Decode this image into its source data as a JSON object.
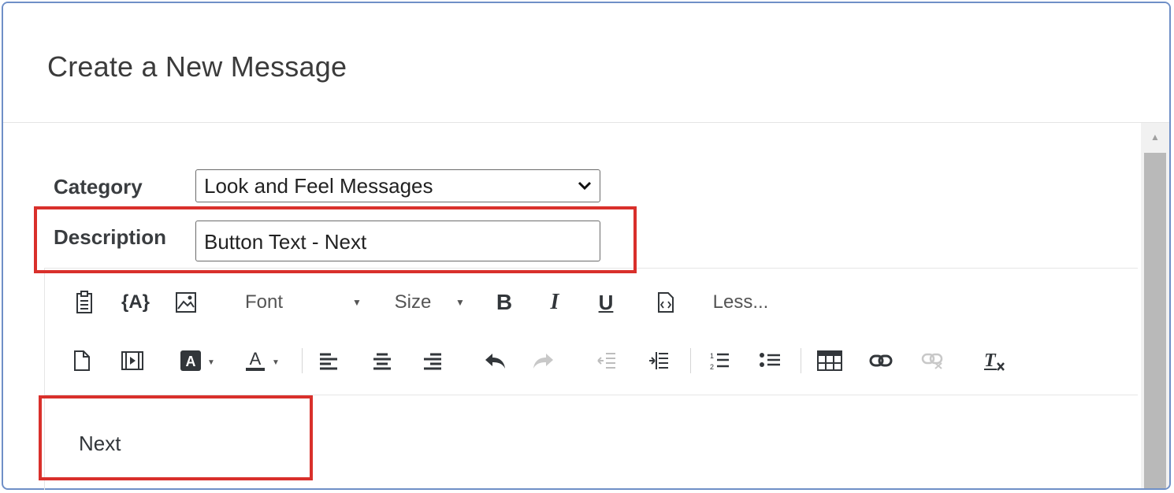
{
  "dialog": {
    "title": "Create a New Message"
  },
  "form": {
    "category_label": "Category",
    "category_value": "Look and Feel Messages",
    "description_label": "Description",
    "description_value": "Button Text - Next"
  },
  "toolbar": {
    "font_label": "Font",
    "size_label": "Size",
    "bold_label": "B",
    "italic_label": "I",
    "underline_label": "U",
    "less_label": "Less...",
    "variable_label": "{A}"
  },
  "editor": {
    "content": "Next"
  },
  "colors": {
    "highlight": "#d9302b",
    "dialog_border": "#6f8fc7"
  }
}
